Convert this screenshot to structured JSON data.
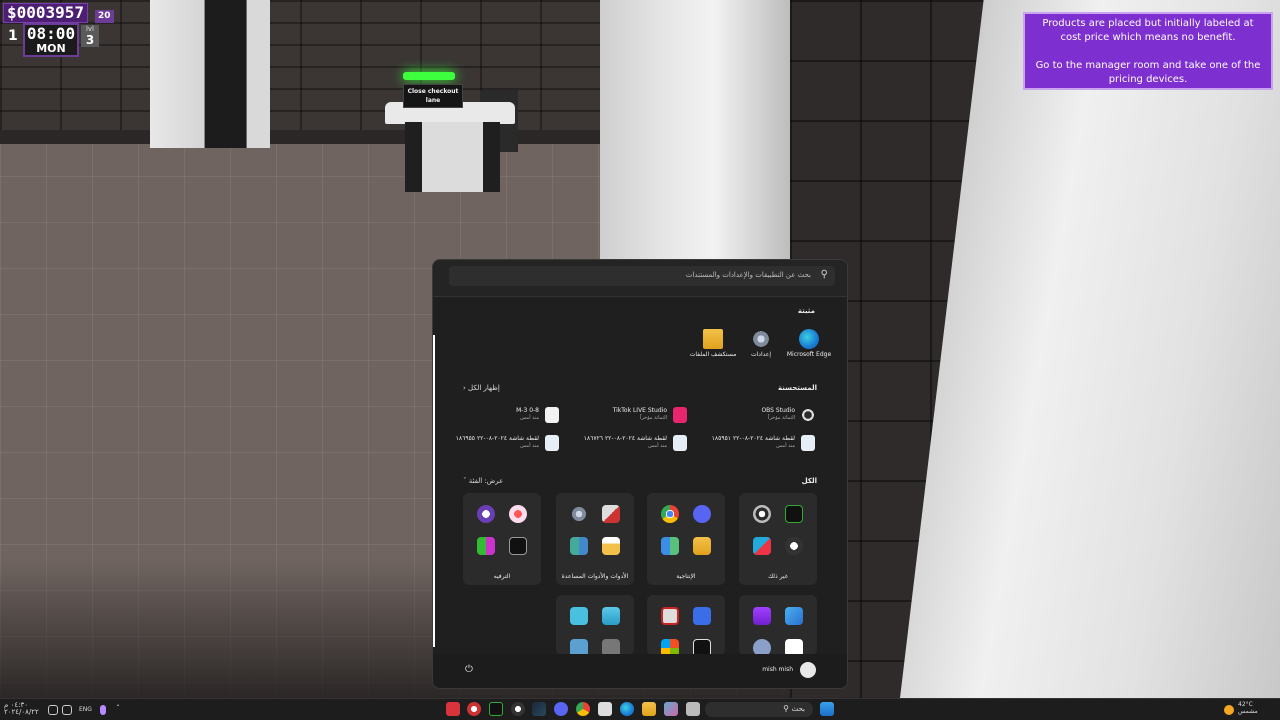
{
  "hud": {
    "money": "$0003957",
    "badge": "20",
    "day": "1",
    "time": "08:00",
    "weekday": "MON",
    "level_label": "lvl",
    "level": "3"
  },
  "tip": {
    "line1": "Products are placed but initially labeled at cost price which means no benefit.",
    "line2": "Go to the manager room and take one of the pricing devices."
  },
  "scene": {
    "checkout_sign": "Close checkout lane"
  },
  "start_menu": {
    "search_placeholder": "بحث عن التطبيقات والإعدادات والمستندات",
    "pinned_title": "مثبتة",
    "pinned": [
      {
        "label": "Microsoft Edge",
        "icon": "edge-icon"
      },
      {
        "label": "إعدادات",
        "icon": "settings-gear-icon"
      },
      {
        "label": "مستكشف الملفات",
        "icon": "file-explorer-folder-icon"
      }
    ],
    "recommended_title": "المستحسنة",
    "show_all": "إظهار الكل",
    "recommended": [
      {
        "title": "OBS Studio",
        "sub": "الثماثة مؤخراً",
        "icon": "obs-icon"
      },
      {
        "title": "TikTok LIVE Studio",
        "sub": "الثماثة مؤخراً",
        "icon": "tiktok-icon"
      },
      {
        "title": "M-3 0-8",
        "sub": "منذ أمس",
        "icon": "media-file-icon"
      },
      {
        "title": "لقطة شاشة ٢٠٢٤-٠٨-٢٢ ١٨٥٩٥١",
        "sub": "منذ أمس",
        "icon": "screenshot-file-icon"
      },
      {
        "title": "لقطة شاشة ٢٠٢٤-٠٨-٢٢ ١٨٦٧٢٦",
        "sub": "منذ أمس",
        "icon": "screenshot-file-icon"
      },
      {
        "title": "لقطة شاشة ٢٠٢٤-٠٨-٢٢ ١٨٦٩٥٥",
        "sub": "منذ أمس",
        "icon": "screenshot-file-icon"
      }
    ],
    "all_title": "الكل",
    "view_label": "عرض: الفئة",
    "categories": [
      {
        "label": "غير ذلك"
      },
      {
        "label": "الإنتاجية"
      },
      {
        "label": "الأدوات والأدوات المساعدة"
      },
      {
        "label": "الترفيه"
      }
    ],
    "user_name": "mish mish"
  },
  "taskbar": {
    "search_label": "بحث",
    "language": "ENG",
    "weather_temp": "42°C",
    "weather_desc": "مشمس",
    "clock_time": "٠٤:٣٠ م",
    "clock_date": "٢٠٢٤/٠٨/٢٢"
  },
  "colors": {
    "hud_purple": "#4c1f72",
    "tip_purple": "#7d2fcf",
    "checkout_green": "#3dff3d",
    "start_bg": "#242424"
  }
}
